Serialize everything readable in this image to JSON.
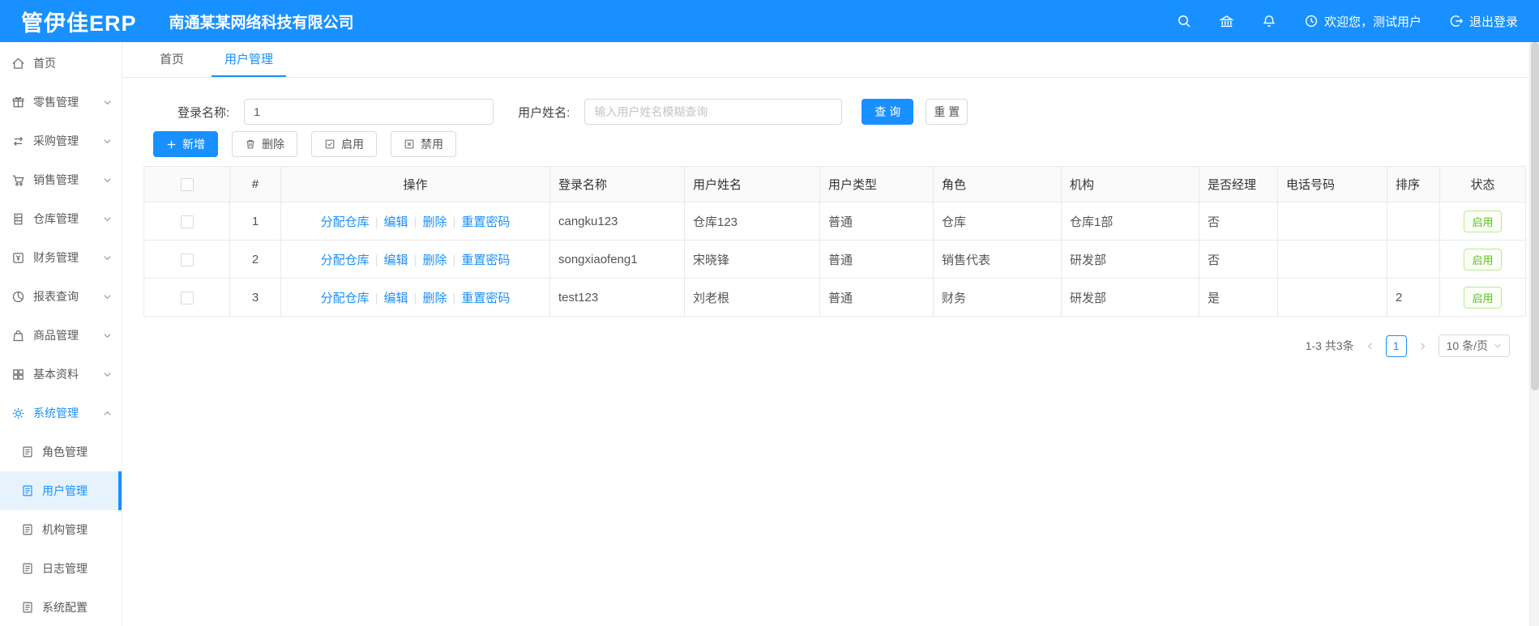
{
  "header": {
    "logo": "管伊佳ERP",
    "company": "南通某某网络科技有限公司",
    "welcome": "欢迎您，测试用户",
    "logout": "退出登录"
  },
  "sidebar": {
    "items": [
      {
        "label": "首页"
      },
      {
        "label": "零售管理"
      },
      {
        "label": "采购管理"
      },
      {
        "label": "销售管理"
      },
      {
        "label": "仓库管理"
      },
      {
        "label": "财务管理"
      },
      {
        "label": "报表查询"
      },
      {
        "label": "商品管理"
      },
      {
        "label": "基本资料"
      },
      {
        "label": "系统管理"
      }
    ],
    "system_subitems": [
      {
        "label": "角色管理"
      },
      {
        "label": "用户管理"
      },
      {
        "label": "机构管理"
      },
      {
        "label": "日志管理"
      },
      {
        "label": "系统配置"
      }
    ]
  },
  "tabs": [
    {
      "label": "首页"
    },
    {
      "label": "用户管理"
    }
  ],
  "filter": {
    "login_label": "登录名称:",
    "login_value": "1",
    "name_label": "用户姓名:",
    "name_placeholder": "输入用户姓名模糊查询",
    "search_label": "查 询",
    "reset_label": "重 置"
  },
  "toolbar": {
    "add": "新增",
    "delete": "删除",
    "enable": "启用",
    "disable": "禁用"
  },
  "table": {
    "headers": [
      "#",
      "操作",
      "登录名称",
      "用户姓名",
      "用户类型",
      "角色",
      "机构",
      "是否经理",
      "电话号码",
      "排序",
      "状态"
    ],
    "action_links": [
      "分配仓库",
      "编辑",
      "删除",
      "重置密码"
    ],
    "rows": [
      {
        "index": "1",
        "login": "cangku123",
        "name": "仓库123",
        "type": "普通",
        "role": "仓库",
        "org": "仓库1部",
        "manager": "否",
        "phone": "",
        "sort": "",
        "status": "启用"
      },
      {
        "index": "2",
        "login": "songxiaofeng1",
        "name": "宋晓锋",
        "type": "普通",
        "role": "销售代表",
        "org": "研发部",
        "manager": "否",
        "phone": "",
        "sort": "",
        "status": "启用"
      },
      {
        "index": "3",
        "login": "test123",
        "name": "刘老根",
        "type": "普通",
        "role": "财务",
        "org": "研发部",
        "manager": "是",
        "phone": "",
        "sort": "2",
        "status": "启用"
      }
    ]
  },
  "pagination": {
    "total_text": "1-3 共3条",
    "current_page": "1",
    "page_size_label": "10 条/页"
  },
  "colors": {
    "primary": "#1890ff",
    "status_enabled": "#52c41a",
    "status_enabled_border": "#b7eb8f",
    "active_submenu_bg": "#e6f3fd",
    "table_header_bg": "#fafafa",
    "border": "#e9e9eb"
  }
}
